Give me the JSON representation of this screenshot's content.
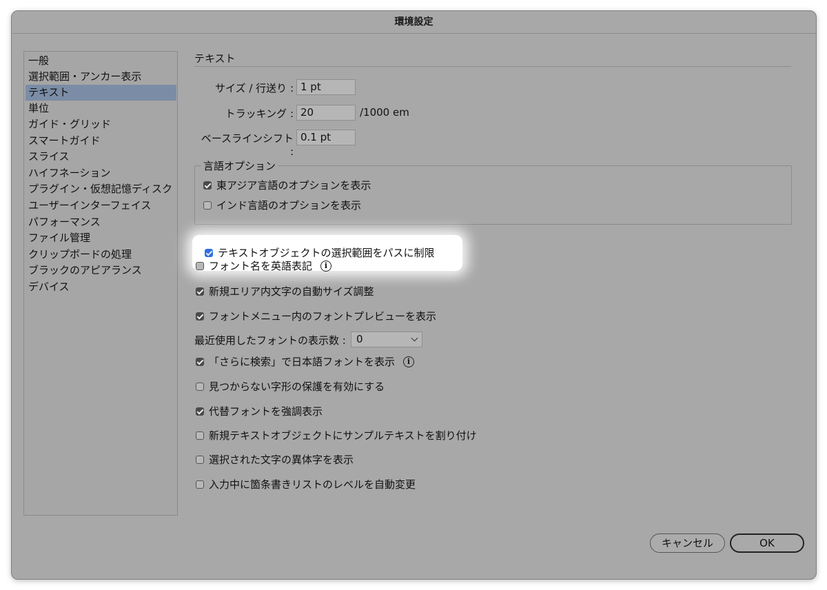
{
  "dialog": {
    "title": "環境設定"
  },
  "sidebar": {
    "items": [
      {
        "label": "一般"
      },
      {
        "label": "選択範囲・アンカー表示"
      },
      {
        "label": "テキスト",
        "selected": true
      },
      {
        "label": "単位"
      },
      {
        "label": "ガイド・グリッド"
      },
      {
        "label": "スマートガイド"
      },
      {
        "label": "スライス"
      },
      {
        "label": "ハイフネーション"
      },
      {
        "label": "プラグイン・仮想記憶ディスク"
      },
      {
        "label": "ユーザーインターフェイス"
      },
      {
        "label": "パフォーマンス"
      },
      {
        "label": "ファイル管理"
      },
      {
        "label": "クリップボードの処理"
      },
      {
        "label": "ブラックのアピアランス"
      },
      {
        "label": "デバイス"
      }
    ]
  },
  "main": {
    "section_title": "テキスト",
    "size_leading": {
      "label": "サイズ / 行送り :",
      "value": "1 pt"
    },
    "tracking": {
      "label": "トラッキング :",
      "value": "20",
      "unit": "/1000 em"
    },
    "baseline_shift": {
      "label": "ベースラインシフト :",
      "value": "0.1 pt"
    },
    "language_group": {
      "title": "言語オプション",
      "options": [
        {
          "label": "東アジア言語のオプションを表示",
          "checked": true
        },
        {
          "label": "インド言語のオプションを表示",
          "checked": false
        }
      ]
    },
    "options": [
      {
        "label": "テキストオブジェクトの選択範囲をパスに制限",
        "checked": true
      },
      {
        "label": "フォント名を英語表記",
        "checked": false,
        "info": true
      },
      {
        "label": "新規エリア内文字の自動サイズ調整",
        "checked": true
      },
      {
        "label": "フォントメニュー内のフォントプレビューを表示",
        "checked": true
      },
      {
        "label": "「さらに検索」で日本語フォントを表示",
        "checked": true,
        "info": true
      },
      {
        "label": "見つからない字形の保護を有効にする",
        "checked": false
      },
      {
        "label": "代替フォントを強調表示",
        "checked": true
      },
      {
        "label": "新規テキストオブジェクトにサンプルテキストを割り付け",
        "checked": false
      },
      {
        "label": "選択された文字の異体字を表示",
        "checked": false
      },
      {
        "label": "入力中に箇条書きリストのレベルを自動変更",
        "checked": false
      }
    ],
    "recent_fonts": {
      "label": "最近使用したフォントの表示数 :",
      "value": "0"
    },
    "info_glyph": "i"
  },
  "buttons": {
    "cancel": "キャンセル",
    "ok": "OK"
  },
  "colors": {
    "dialog_bg": "#a8a8a8",
    "selected_item": "#7b8da6",
    "highlight_check": "#2f6fe0"
  }
}
